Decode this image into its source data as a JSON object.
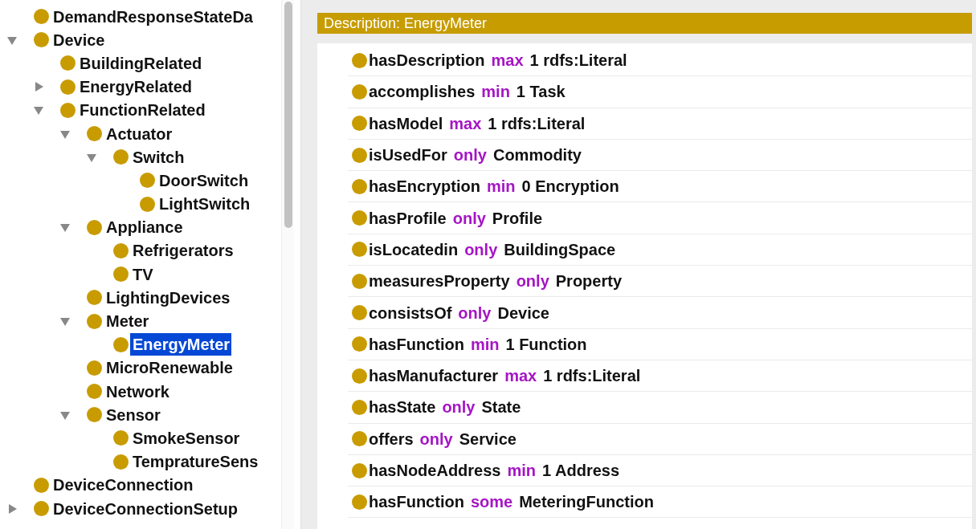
{
  "class_tree": [
    {
      "label": "DemandResponseStateDa",
      "selected": false
    },
    {
      "label": "Device",
      "expanded": true,
      "selected": false,
      "children": [
        {
          "label": "BuildingRelated",
          "selected": false
        },
        {
          "label": "EnergyRelated",
          "expanded": false,
          "selected": false
        },
        {
          "label": "FunctionRelated",
          "expanded": true,
          "selected": false,
          "children": [
            {
              "label": "Actuator",
              "expanded": true,
              "selected": false,
              "children": [
                {
                  "label": "Switch",
                  "expanded": true,
                  "selected": false,
                  "children": [
                    {
                      "label": "DoorSwitch",
                      "selected": false
                    },
                    {
                      "label": "LightSwitch",
                      "selected": false
                    }
                  ]
                }
              ]
            },
            {
              "label": "Appliance",
              "expanded": true,
              "selected": false,
              "children": [
                {
                  "label": "Refrigerators",
                  "selected": false
                },
                {
                  "label": "TV",
                  "selected": false
                }
              ]
            },
            {
              "label": "LightingDevices",
              "selected": false
            },
            {
              "label": "Meter",
              "expanded": true,
              "selected": false,
              "children": [
                {
                  "label": "EnergyMeter",
                  "selected": true
                }
              ]
            },
            {
              "label": "MicroRenewable",
              "selected": false
            },
            {
              "label": "Network",
              "selected": false
            },
            {
              "label": "Sensor",
              "expanded": true,
              "selected": false,
              "children": [
                {
                  "label": "SmokeSensor",
                  "selected": false
                },
                {
                  "label": "TempratureSens",
                  "selected": false
                }
              ]
            }
          ]
        }
      ]
    },
    {
      "label": "DeviceConnection",
      "selected": false
    },
    {
      "label": "DeviceConnectionSetup",
      "expanded": false,
      "selected": false
    }
  ],
  "description": {
    "title": "Description: EnergyMeter",
    "restrictions": [
      {
        "property": "hasDescription",
        "quantifier": "max",
        "filler": "1 rdfs:Literal"
      },
      {
        "property": "accomplishes",
        "quantifier": "min",
        "filler": "1 Task"
      },
      {
        "property": "hasModel",
        "quantifier": "max",
        "filler": "1 rdfs:Literal"
      },
      {
        "property": "isUsedFor",
        "quantifier": "only",
        "filler": "Commodity"
      },
      {
        "property": "hasEncryption",
        "quantifier": "min",
        "filler": "0 Encryption"
      },
      {
        "property": "hasProfile",
        "quantifier": "only",
        "filler": "Profile"
      },
      {
        "property": "isLocatedin",
        "quantifier": "only",
        "filler": "BuildingSpace"
      },
      {
        "property": "measuresProperty",
        "quantifier": "only",
        "filler": "Property"
      },
      {
        "property": "consistsOf",
        "quantifier": "only",
        "filler": "Device"
      },
      {
        "property": "hasFunction",
        "quantifier": "min",
        "filler": "1 Function"
      },
      {
        "property": "hasManufacturer",
        "quantifier": "max",
        "filler": "1 rdfs:Literal"
      },
      {
        "property": "hasState",
        "quantifier": "only",
        "filler": "State"
      },
      {
        "property": "offers",
        "quantifier": "only",
        "filler": "Service"
      },
      {
        "property": "hasNodeAddress",
        "quantifier": "min",
        "filler": "1 Address"
      },
      {
        "property": "hasFunction",
        "quantifier": "some",
        "filler": "MeteringFunction"
      }
    ]
  }
}
